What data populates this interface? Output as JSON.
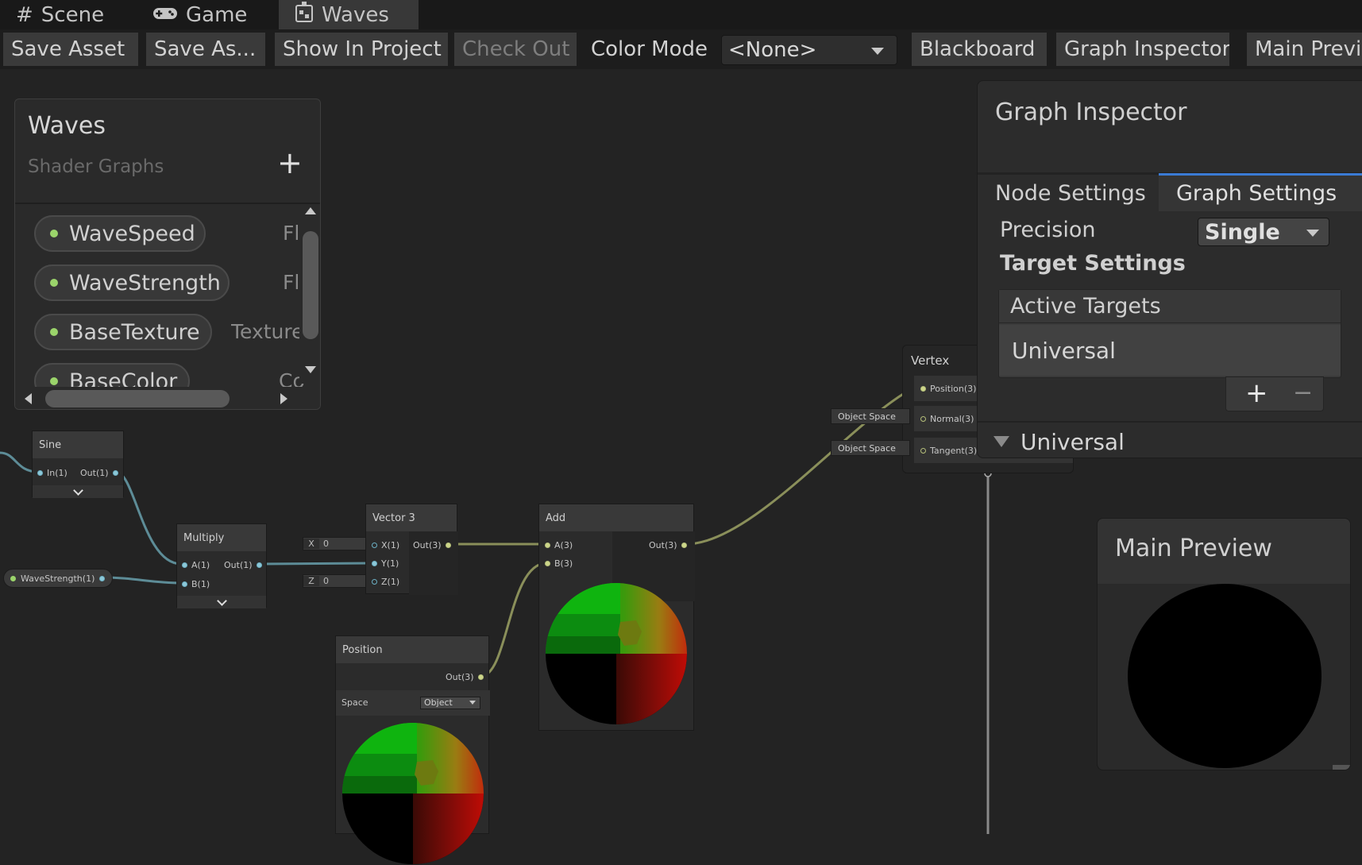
{
  "tabs": [
    {
      "label": "Scene",
      "icon": "hash-icon"
    },
    {
      "label": "Game",
      "icon": "gamepad-icon"
    },
    {
      "label": "Waves",
      "icon": "shader-graph-icon",
      "active": true
    }
  ],
  "toolbar": {
    "save_asset": "Save Asset",
    "save_as": "Save As...",
    "show_in_project": "Show In Project",
    "check_out": "Check Out",
    "color_mode_label": "Color Mode",
    "color_mode_value": "<None>",
    "blackboard": "Blackboard",
    "graph_inspector": "Graph Inspector",
    "main_preview": "Main Previ"
  },
  "blackboard": {
    "title": "Waves",
    "subtitle": "Shader Graphs",
    "add_symbol": "+",
    "properties": [
      {
        "name": "WaveSpeed",
        "type": "Fl"
      },
      {
        "name": "WaveStrength",
        "type": "Fl"
      },
      {
        "name": "BaseTexture",
        "type": "Texture"
      },
      {
        "name": "BaseColor",
        "type": "Co"
      }
    ]
  },
  "nodes": {
    "sine": {
      "title": "Sine",
      "in": "In(1)",
      "out": "Out(1)"
    },
    "multiply": {
      "title": "Multiply",
      "a": "A(1)",
      "b": "B(1)",
      "out": "Out(1)"
    },
    "wavestrength": {
      "label": "WaveStrength(1)"
    },
    "vector3": {
      "title": "Vector 3",
      "x": "X(1)",
      "y": "Y(1)",
      "z": "Z(1)",
      "out": "Out(3)",
      "x_label": "X",
      "x_value": "0",
      "z_label": "Z",
      "z_value": "0"
    },
    "add": {
      "title": "Add",
      "a": "A(3)",
      "b": "B(3)",
      "out": "Out(3)"
    },
    "position": {
      "title": "Position",
      "out": "Out(3)",
      "space_label": "Space",
      "space_value": "Object"
    },
    "vertex": {
      "title": "Vertex",
      "position": "Position(3)",
      "normal": "Normal(3)",
      "tangent": "Tangent(3)",
      "normal_space": "Object Space",
      "tangent_space": "Object Space"
    }
  },
  "inspector": {
    "title": "Graph Inspector",
    "tab_node": "Node Settings",
    "tab_graph": "Graph Settings",
    "precision_label": "Precision",
    "precision_value": "Single",
    "target_settings": "Target Settings",
    "active_targets": "Active Targets",
    "target_item": "Universal",
    "add": "+",
    "remove": "−",
    "section": "Universal"
  },
  "preview": {
    "title": "Main Preview"
  },
  "colors": {
    "wire_vector": "#8a8f5a",
    "wire_float": "#5d8c97",
    "panel": "#2a2a2a",
    "accent": "#3a7bd5",
    "property_dot": "#9bd46b"
  }
}
